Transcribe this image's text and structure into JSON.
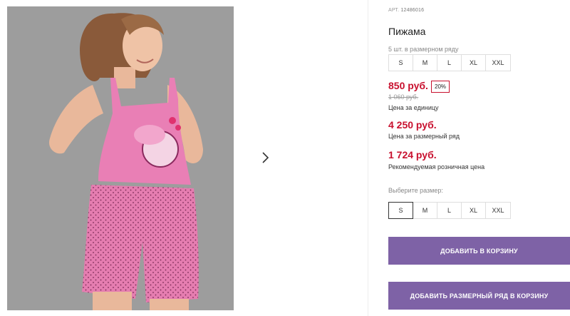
{
  "product": {
    "article_label": "АРТ.",
    "article_value": "12486016",
    "title": "Пижама",
    "pack_note": "5 шт. в размерном ряду",
    "pack_sizes": [
      "S",
      "M",
      "L",
      "XL",
      "XXL"
    ],
    "price": "850 руб.",
    "discount": "20%",
    "old_price": "1 060 руб.",
    "price_caption": "Цена за единицу",
    "pack_price": "4 250 руб.",
    "pack_price_caption": "Цена за размерный ряд",
    "retail_price": "1 724 руб.",
    "retail_price_caption": "Рекомендуемая розничная цена",
    "choose_size_label": "Выберите размер:",
    "size_options": [
      "S",
      "M",
      "L",
      "XL",
      "XXL"
    ],
    "selected_size": "S"
  },
  "buttons": {
    "add_to_cart": "ДОБАВИТЬ В КОРЗИНУ",
    "add_pack_to_cart": "ДОБАВИТЬ РАЗМЕРНЫЙ РЯД В КОРЗИНУ"
  },
  "gallery": {
    "next_icon": "chevron-right-icon"
  },
  "colors": {
    "accent": "#7e62a6",
    "price": "#c8102e",
    "product_pink": "#e97fb5"
  }
}
